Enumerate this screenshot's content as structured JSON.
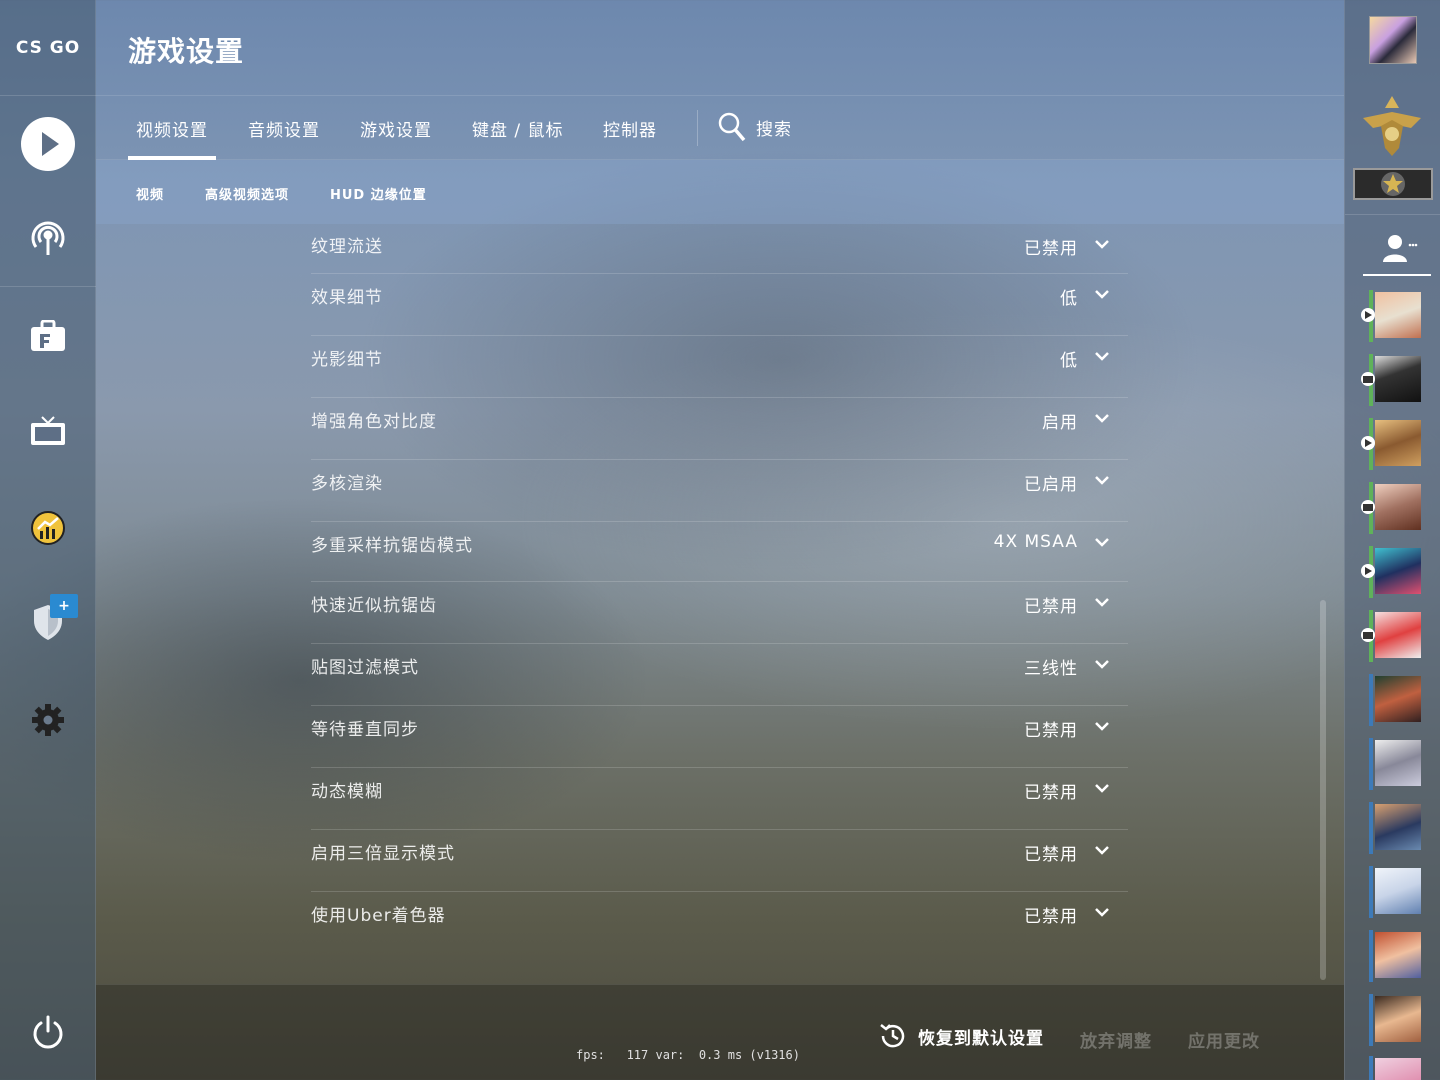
{
  "app": {
    "logo": "CS GO",
    "title": "游戏设置"
  },
  "nav": {
    "play": "play-icon",
    "broadcast": "broadcast-icon",
    "inventory": "briefcase-icon",
    "watch": "tv-icon",
    "stats": "stats-icon",
    "operation": "shield-icon",
    "operation_badge": "+",
    "settings": "gear-icon",
    "power": "power-icon"
  },
  "tabs": [
    {
      "label": "视频设置",
      "active": true
    },
    {
      "label": "音频设置",
      "active": false
    },
    {
      "label": "游戏设置",
      "active": false
    },
    {
      "label": "键盘 / 鼠标",
      "active": false
    },
    {
      "label": "控制器",
      "active": false
    }
  ],
  "search": {
    "label": "搜索",
    "icon": "search-icon"
  },
  "subtabs": [
    {
      "label": "视频"
    },
    {
      "label": "高级视频选项"
    },
    {
      "label": "HUD 边缘位置"
    }
  ],
  "settings": [
    {
      "label": "纹理流送",
      "value": "已禁用"
    },
    {
      "label": "效果细节",
      "value": "低"
    },
    {
      "label": "光影细节",
      "value": "低"
    },
    {
      "label": "增强角色对比度",
      "value": "启用"
    },
    {
      "label": "多核渲染",
      "value": "已启用"
    },
    {
      "label": "多重采样抗锯齿模式",
      "value": "4X MSAA"
    },
    {
      "label": "快速近似抗锯齿",
      "value": "已禁用"
    },
    {
      "label": "贴图过滤模式",
      "value": "三线性"
    },
    {
      "label": "等待垂直同步",
      "value": "已禁用"
    },
    {
      "label": "动态模糊",
      "value": "已禁用"
    },
    {
      "label": "启用三倍显示模式",
      "value": "已禁用"
    },
    {
      "label": "使用Uber着色器",
      "value": "已禁用"
    }
  ],
  "footer": {
    "reset": "恢复到默认设置",
    "discard": "放弃调整",
    "apply": "应用更改",
    "fps_text": "fps:   117 var:  0.3 ms (v1316)"
  },
  "colors": {
    "online_bar": "#5fb25a",
    "offline_bar": "#3d7ab8",
    "badge": "#2a8ad1"
  }
}
